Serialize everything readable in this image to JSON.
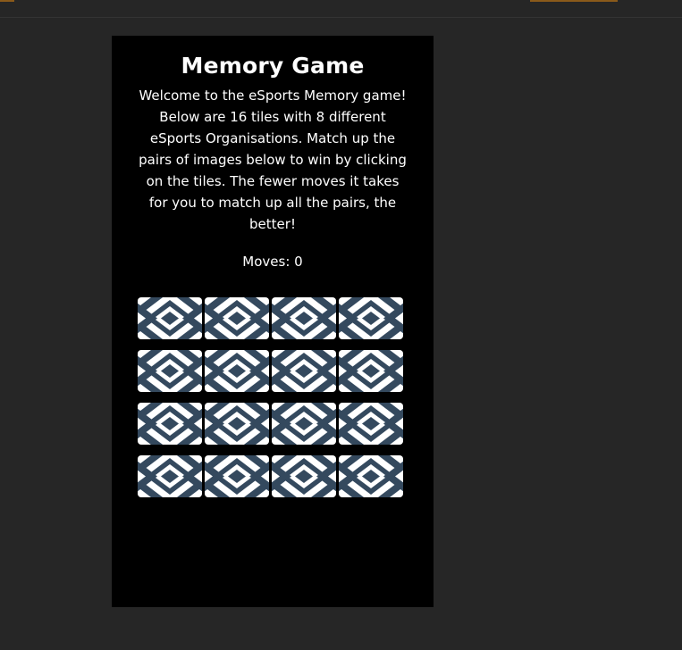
{
  "game": {
    "title": "Memory Game",
    "intro": "Welcome to the eSports Memory game! Below are 16 tiles with 8 different eSports Organisations. Match up the pairs of images below to win by clicking on the tiles. The fewer moves it takes for you to match up all the pairs, the better!",
    "moves_label": "Moves:",
    "moves_value": "0"
  },
  "board": {
    "rows": 4,
    "columns": 4,
    "tile_count": 16,
    "tile_back_icon": "diamond-pattern-icon",
    "colors": {
      "tile_background": "#ffffff",
      "tile_pattern": "#34495e"
    }
  },
  "colors": {
    "page_background": "#262626",
    "panel_background": "#000000",
    "text": "#ffffff",
    "accent": "#8a5a1a"
  }
}
